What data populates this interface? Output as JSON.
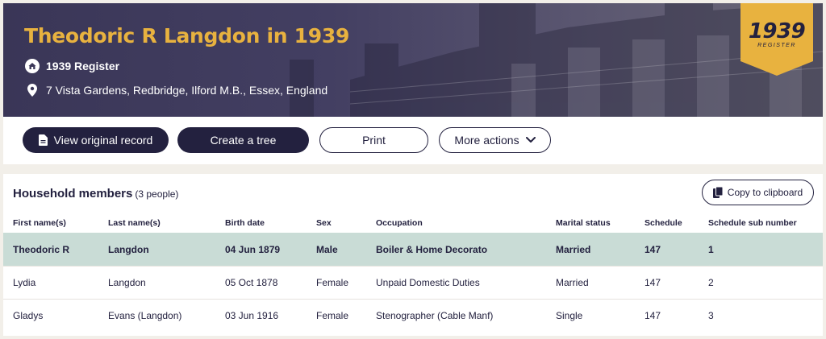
{
  "header": {
    "title": "Theodoric R Langdon in 1939",
    "register_label": "1939 Register",
    "address": "7 Vista Gardens, Redbridge, Ilford M.B., Essex, England",
    "ribbon_year": "1939",
    "ribbon_sub": "REGISTER",
    "ribbon_color": "#e8b23f"
  },
  "actions": {
    "view_original": "View original record",
    "create_tree": "Create a tree",
    "print": "Print",
    "more_actions": "More actions"
  },
  "household": {
    "title": "Household members",
    "count": "(3 people)",
    "copy_label": "Copy to clipboard",
    "columns": [
      "First name(s)",
      "Last name(s)",
      "Birth date",
      "Sex",
      "Occupation",
      "Marital status",
      "Schedule",
      "Schedule sub number"
    ],
    "rows": [
      [
        "Theodoric R",
        "Langdon",
        "04 Jun 1879",
        "Male",
        "Boiler & Home Decorato",
        "Married",
        "147",
        "1"
      ],
      [
        "Lydia",
        "Langdon",
        "05 Oct 1878",
        "Female",
        "Unpaid Domestic Duties",
        "Married",
        "147",
        "2"
      ],
      [
        "Gladys",
        "Evans (Langdon)",
        "03 Jun 1916",
        "Female",
        "Stenographer (Cable Manf)",
        "Single",
        "147",
        "3"
      ]
    ],
    "highlight_color": "#c9dcd6"
  },
  "icons": {
    "register": "register-house-icon",
    "location": "location-pin-icon",
    "document": "document-icon",
    "chevron": "chevron-down-icon",
    "copy": "copy-icon"
  }
}
